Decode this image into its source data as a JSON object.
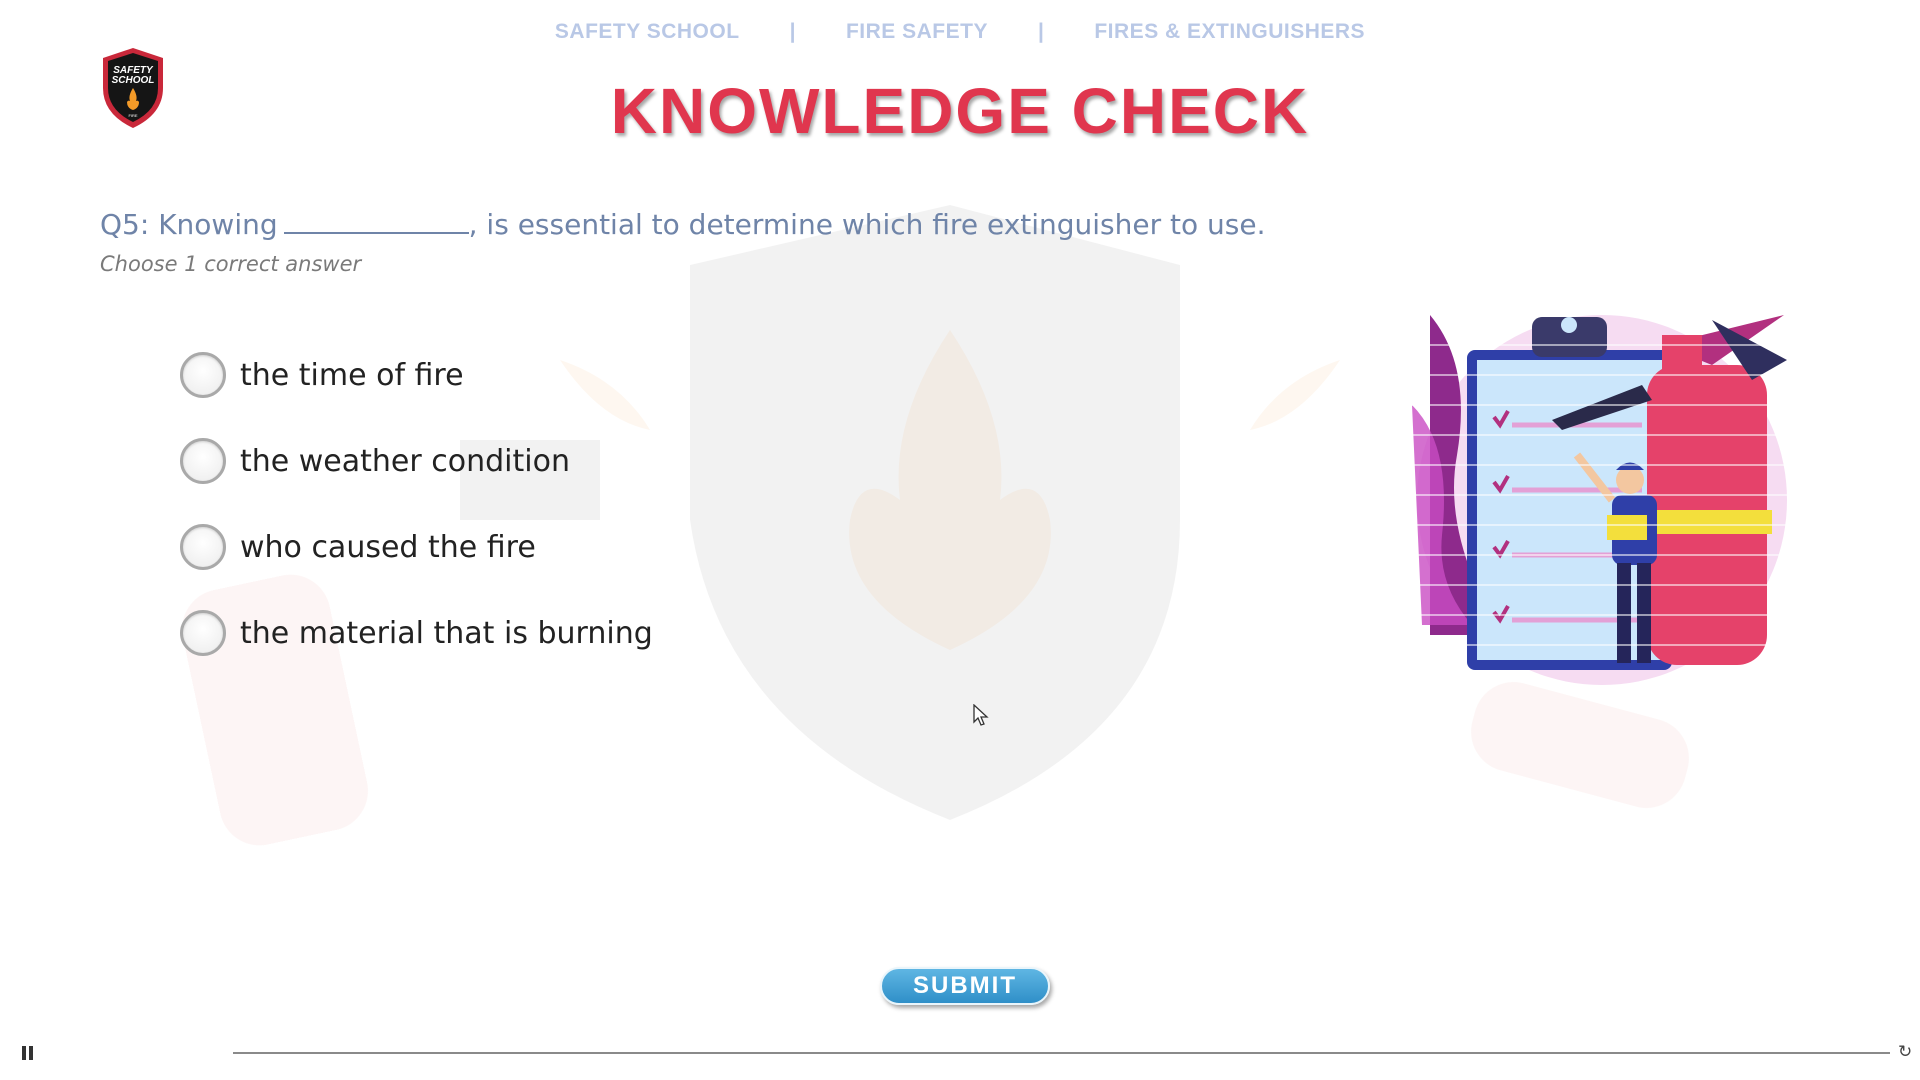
{
  "breadcrumb": {
    "items": [
      "SAFETY SCHOOL",
      "FIRE SAFETY",
      "FIRES & EXTINGUISHERS"
    ],
    "separator": "|"
  },
  "logo": {
    "text_line1": "SAFETY",
    "text_line2": "SCHOOL",
    "text_line3": "FIRE"
  },
  "title": "KNOWLEDGE CHECK",
  "question": {
    "prefix": "Q5: Knowing",
    "suffix": ", is essential to determine which fire extinguisher to use.",
    "instruction": "Choose 1 correct answer"
  },
  "options": [
    {
      "label": "the time of fire",
      "selected": false
    },
    {
      "label": "the weather condition",
      "selected": false
    },
    {
      "label": "who caused the fire",
      "selected": false
    },
    {
      "label": "the material that is burning",
      "selected": false
    }
  ],
  "submit": {
    "label": "SUBMIT"
  },
  "player": {
    "progress_fraction": 0.0,
    "pause_icon": "pause-icon",
    "replay_icon": "replay-icon"
  },
  "colors": {
    "title": "#e0364e",
    "breadcrumb": "#b9c8e6",
    "question": "#6f84a8",
    "submit": "#2f8fc8"
  }
}
